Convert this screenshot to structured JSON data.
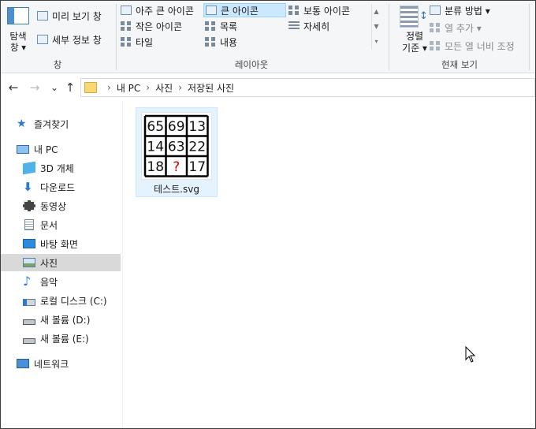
{
  "ribbon": {
    "pane_group": {
      "nav_pane_label_line1": "탐색",
      "nav_pane_label_line2": "창 ▾",
      "preview_pane": "미리 보기 창",
      "details_pane": "세부 정보 창",
      "group_label": "창"
    },
    "layout_group": {
      "items": [
        "아주 큰 아이콘",
        "큰 아이콘",
        "보통 아이콘",
        "작은 아이콘",
        "목록",
        "자세히",
        "타일",
        "내용"
      ],
      "selected": "큰 아이콘",
      "group_label": "레이아웃"
    },
    "current_view_group": {
      "sort_line1": "정렬",
      "sort_line2": "기준 ▾",
      "group_by": "분류 방법 ▾",
      "add_columns": "열 추가 ▾",
      "size_all_columns": "모든 열 너비 조정",
      "group_label": "현재 보기"
    }
  },
  "address": {
    "back": "←",
    "forward": "→",
    "recent": "⌄",
    "up": "↑",
    "crumbs": [
      "내 PC",
      "사진",
      "저장된 사진"
    ],
    "separator": "›"
  },
  "navpane": {
    "quick_access": "즐겨찾기",
    "this_pc": "내 PC",
    "items": [
      "3D 개체",
      "다운로드",
      "동영상",
      "문서",
      "바탕 화면",
      "사진",
      "음악",
      "로컬 디스크 (C:)",
      "새 볼륨 (D:)",
      "새 볼륨 (E:)"
    ],
    "selected": "사진",
    "network": "네트워크"
  },
  "content": {
    "files": [
      {
        "name": "테스트.svg",
        "thumbnail_grid": [
          [
            "65",
            "69",
            "13"
          ],
          [
            "14",
            "63",
            "22"
          ],
          [
            "18",
            "?",
            "17"
          ]
        ]
      }
    ]
  },
  "colors": {
    "selection_bg": "#e5f3ff",
    "ribbon_bg": "#f5f6f7",
    "question_mark": "#cc0000",
    "nav_selected": "#d9d9d9"
  }
}
